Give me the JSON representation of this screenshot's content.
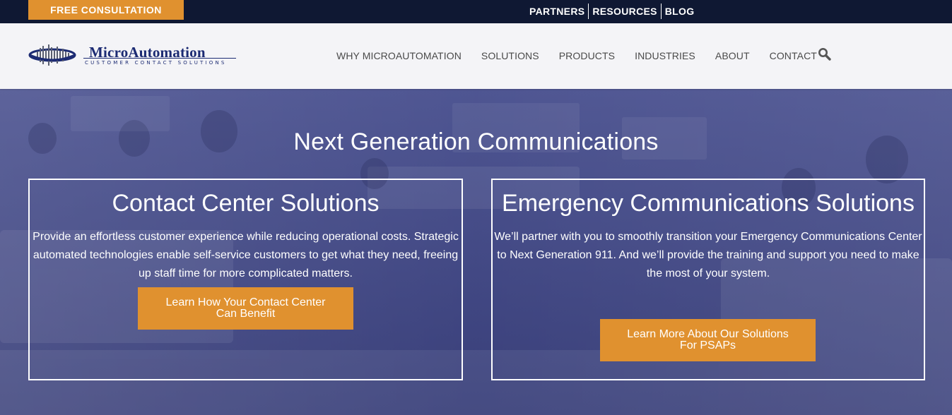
{
  "topbar": {
    "consultation_label": "FREE CONSULTATION",
    "links": [
      "PARTNERS",
      "RESOURCES",
      "BLOG"
    ]
  },
  "header": {
    "logo": {
      "name": "MicroAutomation",
      "tagline": "CUSTOMER CONTACT SOLUTIONS"
    },
    "nav": [
      "WHY MICROAUTOMATION",
      "SOLUTIONS",
      "PRODUCTS",
      "INDUSTRIES",
      "ABOUT",
      "CONTACT"
    ],
    "search_icon": "search-icon"
  },
  "hero": {
    "title": "Next Generation Communications",
    "cards": [
      {
        "title": "Contact Center Solutions",
        "body": "Provide an effortless customer experience while reducing operational costs. Strategic automated technologies enable self-service customers to get what they need, freeing up staff time for more complicated matters.",
        "button": "Learn How Your Contact Center Can Benefit"
      },
      {
        "title": "Emergency Communications Solutions",
        "body": "We’ll partner with you to smoothly transition your Emergency Communications Center to Next Generation 911. And we’ll provide the training and support you need to make the most of your system.",
        "button": "Learn More About Our Solutions For PSAPs"
      }
    ]
  },
  "colors": {
    "topbar_bg": "#0f1833",
    "accent_orange": "#e0912f",
    "header_bg": "#f4f4f7",
    "brand_blue": "#1c2b73",
    "hero_overlay": "#3b4280",
    "nav_text": "#4a4a4a"
  }
}
